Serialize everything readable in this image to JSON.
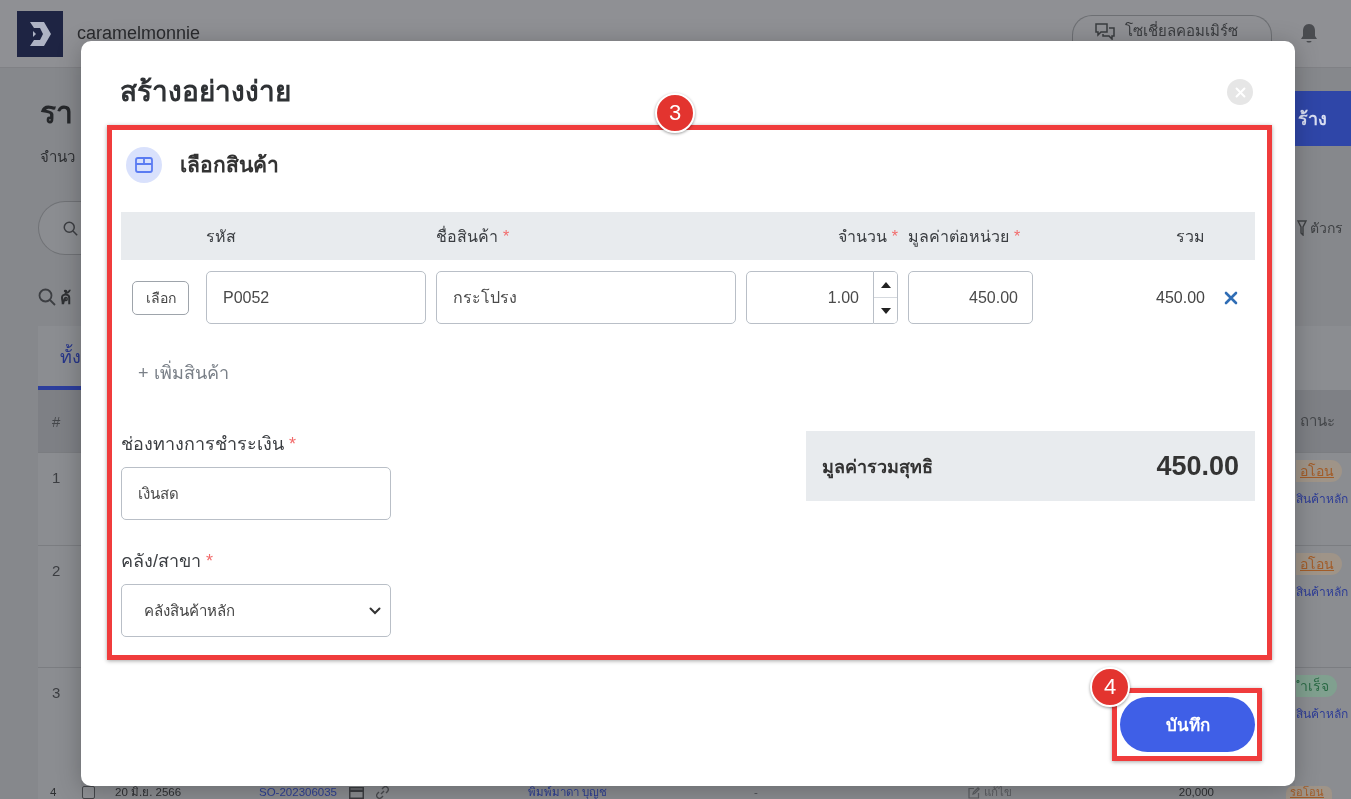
{
  "page": {
    "header": {
      "brand": "caramelmonnie",
      "social_button": "โซเชี่ยลคอมเมิร์ซ"
    },
    "title": "รา",
    "subtitle": "จำนว",
    "create_button": "ร้าง",
    "filter_button": "ตัวกร",
    "search_heading": "ค้",
    "tabs": [
      {
        "label": "ทั้ง",
        "selected": true
      }
    ],
    "table": {
      "columns": [
        "#",
        "ถานะ"
      ],
      "rows": [
        {
          "number": "1",
          "status": {
            "label": "อโอน",
            "kind": "pending"
          },
          "warehouse": "สินค้าหลัก"
        },
        {
          "number": "2",
          "status": {
            "label": "อโอน",
            "kind": "pending"
          },
          "warehouse": "สินค้าหลัก"
        },
        {
          "number": "3",
          "status": {
            "label": "ำเร็จ",
            "kind": "success"
          },
          "warehouse": "สินค้าหลัก"
        }
      ],
      "partial_row": {
        "number": "4",
        "checked": false,
        "date": "20 มิ.ย. 2566",
        "order_number": "SO-202306035",
        "customer": "พิมพ์มาดา บุญช",
        "column_6": "-",
        "edit": "แก้ไข",
        "amount": "20,000",
        "status": {
          "label": "รอโอน",
          "kind": "pending"
        }
      }
    }
  },
  "modal": {
    "title": "สร้างอย่างง่าย",
    "section_title": "เลือกสินค้า",
    "item_table": {
      "columns": [
        {
          "label": "รหัส"
        },
        {
          "label": "ชื่อสินค้า",
          "required_mark": "*"
        },
        {
          "label": "จำนวน",
          "required_mark": "*"
        },
        {
          "label": "มูลค่าต่อหน่วย",
          "required_mark": "*"
        },
        {
          "label": "รวม"
        }
      ],
      "rows": [
        {
          "select_button": "เลือก",
          "code": "P0052",
          "name": "กระโปรง",
          "quantity": "1.00",
          "unit_price": "450.00",
          "total": "450.00"
        }
      ]
    },
    "add_item": "+ เพิ่มสินค้า",
    "payment": {
      "label": "ช่องทางการชำระเงิน",
      "required_mark": "*",
      "value": "เงินสด"
    },
    "warehouse": {
      "label": "คลัง/สาขา",
      "required_mark": "*",
      "value": "คลังสินค้าหลัก"
    },
    "summary": {
      "label": "มูลค่ารวมสุทธิ",
      "value": "450.00"
    },
    "save_button": "บันทึก"
  },
  "annotations": [
    {
      "kind": "section",
      "number": "3"
    },
    {
      "kind": "button",
      "number": "4"
    }
  ]
}
